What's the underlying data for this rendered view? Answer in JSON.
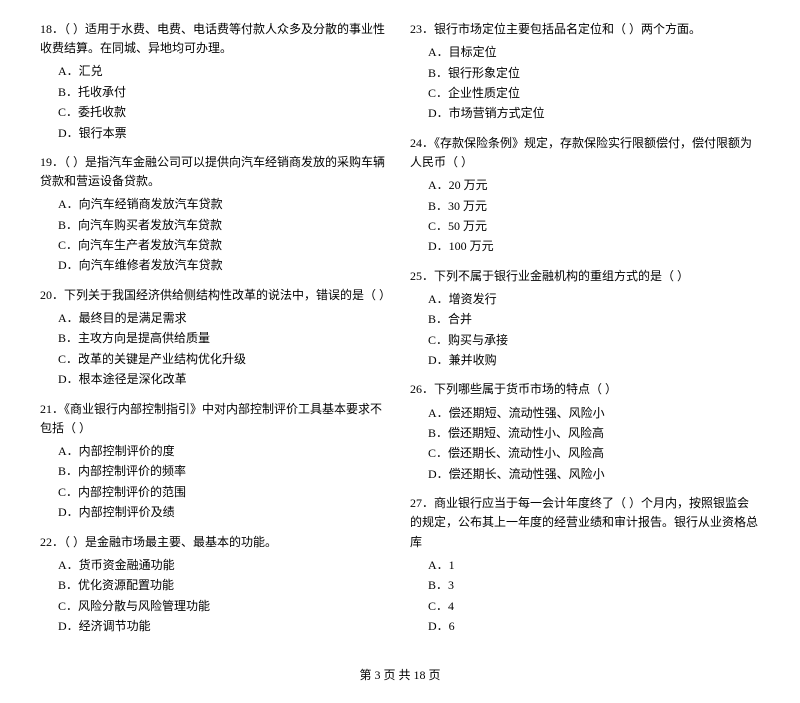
{
  "leftColumn": [
    {
      "id": "q18",
      "title": "18．（    ）适用于水费、电费、电话费等付款人众多及分散的事业性收费结算。在同城、异地均可办理。",
      "options": [
        "A．汇兑",
        "B．托收承付",
        "C．委托收款",
        "D．银行本票"
      ]
    },
    {
      "id": "q19",
      "title": "19．（    ）是指汽车金融公司可以提供向汽车经销商发放的采购车辆贷款和营运设备贷款。",
      "options": [
        "A．向汽车经销商发放汽车贷款",
        "B．向汽车购买者发放汽车贷款",
        "C．向汽车生产者发放汽车贷款",
        "D．向汽车维修者发放汽车贷款"
      ]
    },
    {
      "id": "q20",
      "title": "20．下列关于我国经济供给侧结构性改革的说法中，错误的是（    ）",
      "options": [
        "A．最终目的是满足需求",
        "B．主攻方向是提高供给质量",
        "C．改革的关键是产业结构优化升级",
        "D．根本途径是深化改革"
      ]
    },
    {
      "id": "q21",
      "title": "21．《商业银行内部控制指引》中对内部控制评价工具基本要求不包括（    ）",
      "options": [
        "A．内部控制评价的度",
        "B．内部控制评价的频率",
        "C．内部控制评价的范围",
        "D．内部控制评价及绩"
      ]
    },
    {
      "id": "q22",
      "title": "22．（    ）是金融市场最主要、最基本的功能。",
      "options": [
        "A．货币资金融通功能",
        "B．优化资源配置功能",
        "C．风险分散与风险管理功能",
        "D．经济调节功能"
      ]
    }
  ],
  "rightColumn": [
    {
      "id": "q23",
      "title": "23．银行市场定位主要包括品名定位和（    ）两个方面。",
      "options": [
        "A．目标定位",
        "B．银行形象定位",
        "C．企业性质定位",
        "D．市场营销方式定位"
      ]
    },
    {
      "id": "q24",
      "title": "24．《存款保险条例》规定，存款保险实行限额偿付，偿付限额为人民币（    ）",
      "options": [
        "A．20 万元",
        "B．30 万元",
        "C．50 万元",
        "D．100 万元"
      ]
    },
    {
      "id": "q25",
      "title": "25．下列不属于银行业金融机构的重组方式的是（    ）",
      "options": [
        "A．增资发行",
        "B．合并",
        "C．购买与承接",
        "D．兼并收购"
      ]
    },
    {
      "id": "q26",
      "title": "26．下列哪些属于货币市场的特点（    ）",
      "options": [
        "A．偿还期短、流动性强、风险小",
        "B．偿还期短、流动性小、风险高",
        "C．偿还期长、流动性小、风险高",
        "D．偿还期长、流动性强、风险小"
      ]
    },
    {
      "id": "q27",
      "title": "27．商业银行应当于每一会计年度终了（    ）个月内，按照银监会的规定，公布其上一年度的经营业绩和审计报告。银行从业资格总库",
      "options": [
        "A．1",
        "B．3",
        "C．4",
        "D．6"
      ]
    }
  ],
  "footer": "第 3 页 共 18 页"
}
